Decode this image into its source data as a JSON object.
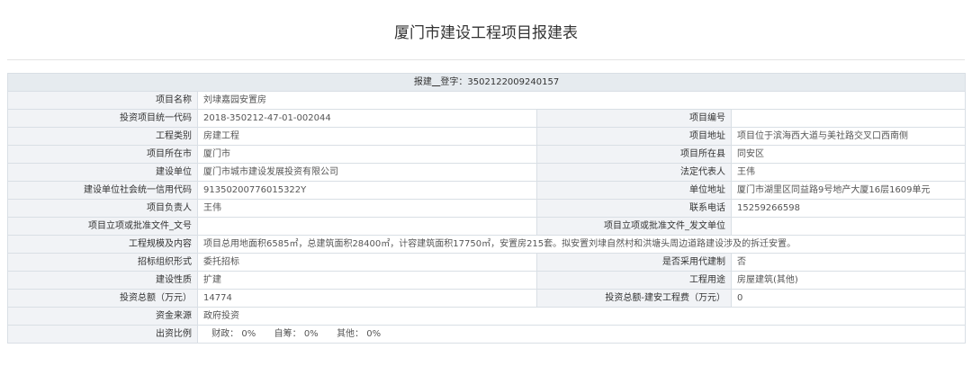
{
  "page": {
    "title": "厦门市建设工程项目报建表"
  },
  "table_header": {
    "prefix": "报建",
    "middle": "登字",
    "number": "3502122009240157"
  },
  "rows": [
    {
      "label": "项目名称",
      "value": "刘埭嘉园安置房"
    },
    {
      "label": "投资项目统一代码",
      "value": "2018-350212-47-01-002044",
      "label2": "项目编号",
      "value2": ""
    },
    {
      "label": "工程类别",
      "value": "房建工程",
      "label2": "项目地址",
      "value2": "项目位于滨海西大道与美社路交叉口西南侧"
    },
    {
      "label": "项目所在市",
      "value": "厦门市",
      "label2": "项目所在县",
      "value2": "同安区"
    },
    {
      "label": "建设单位",
      "value": "厦门市城市建设发展投资有限公司",
      "label2": "法定代表人",
      "value2": "王伟"
    },
    {
      "label": "建设单位社会统一信用代码",
      "value": "91350200776015322Y",
      "label2": "单位地址",
      "value2": "厦门市湖里区同益路9号地产大厦16层1609单元"
    },
    {
      "label": "项目负责人",
      "value": "王伟",
      "label2": "联系电话",
      "value2": "15259266598"
    },
    {
      "label": "项目立项或批准文件_文号",
      "value": "",
      "label2": "项目立项或批准文件_发文单位",
      "value2": ""
    },
    {
      "label": "工程规模及内容",
      "value": "项目总用地面积6585㎡，总建筑面积28400㎡，计容建筑面积17750㎡，安置房215套。拟安置刘埭自然村和洪塘头周边道路建设涉及的拆迁安置。"
    },
    {
      "label": "招标组织形式",
      "value": "委托招标",
      "label2": "是否采用代建制",
      "value2": "否"
    },
    {
      "label": "建设性质",
      "value": "扩建",
      "label2": "工程用途",
      "value2": "房屋建筑(其他)"
    },
    {
      "label": "投资总额（万元）",
      "value": "14774",
      "label2": "投资总额-建安工程费（万元）",
      "value2": "0"
    },
    {
      "label": "资金来源",
      "value": "政府投资"
    }
  ],
  "ratio": {
    "label": "出资比例",
    "items": [
      {
        "name": "财政：",
        "value": "0%"
      },
      {
        "name": "自筹：",
        "value": "0%"
      },
      {
        "name": "其他：",
        "value": "0%"
      }
    ]
  }
}
